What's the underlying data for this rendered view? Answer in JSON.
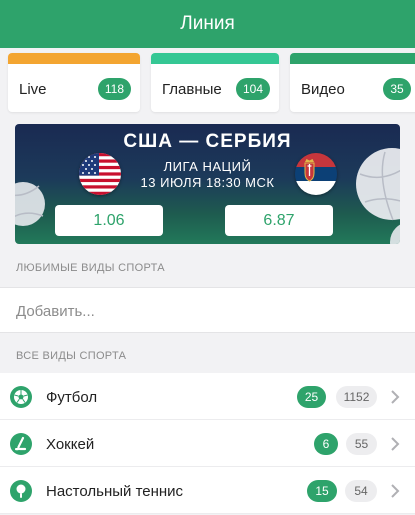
{
  "header": {
    "title": "Линия"
  },
  "tabs": [
    {
      "label": "Live",
      "count": "118",
      "color": "#f3a531"
    },
    {
      "label": "Главные",
      "count": "104",
      "color": "#35c794"
    },
    {
      "label": "Видео",
      "count": "35",
      "color": "#2ea36b"
    }
  ],
  "banner": {
    "title": "США — СЕРБИЯ",
    "league": "ЛИГА НАЦИЙ",
    "datetime": "13 ИЮЛЯ 18:30 МСК",
    "odd1": "1.06",
    "odd2": "6.87",
    "team1_flag": "usa-flag-icon",
    "team2_flag": "serbia-flag-icon"
  },
  "favorites": {
    "section_title": "ЛЮБИМЫЕ ВИДЫ СПОРТА",
    "add_placeholder": "Добавить..."
  },
  "all_sports": {
    "section_title": "ВСЕ ВИДЫ СПОРТА",
    "items": [
      {
        "name": "Футбол",
        "live": "25",
        "total": "1152",
        "icon": "soccer-ball-icon"
      },
      {
        "name": "Хоккей",
        "live": "6",
        "total": "55",
        "icon": "hockey-stick-icon"
      },
      {
        "name": "Настольный теннис",
        "live": "15",
        "total": "54",
        "icon": "table-tennis-icon"
      }
    ]
  },
  "colors": {
    "accent": "#2ea36b",
    "live_tab": "#f3a531",
    "main_tab": "#35c794",
    "banner_bg": "#1a2a52"
  }
}
